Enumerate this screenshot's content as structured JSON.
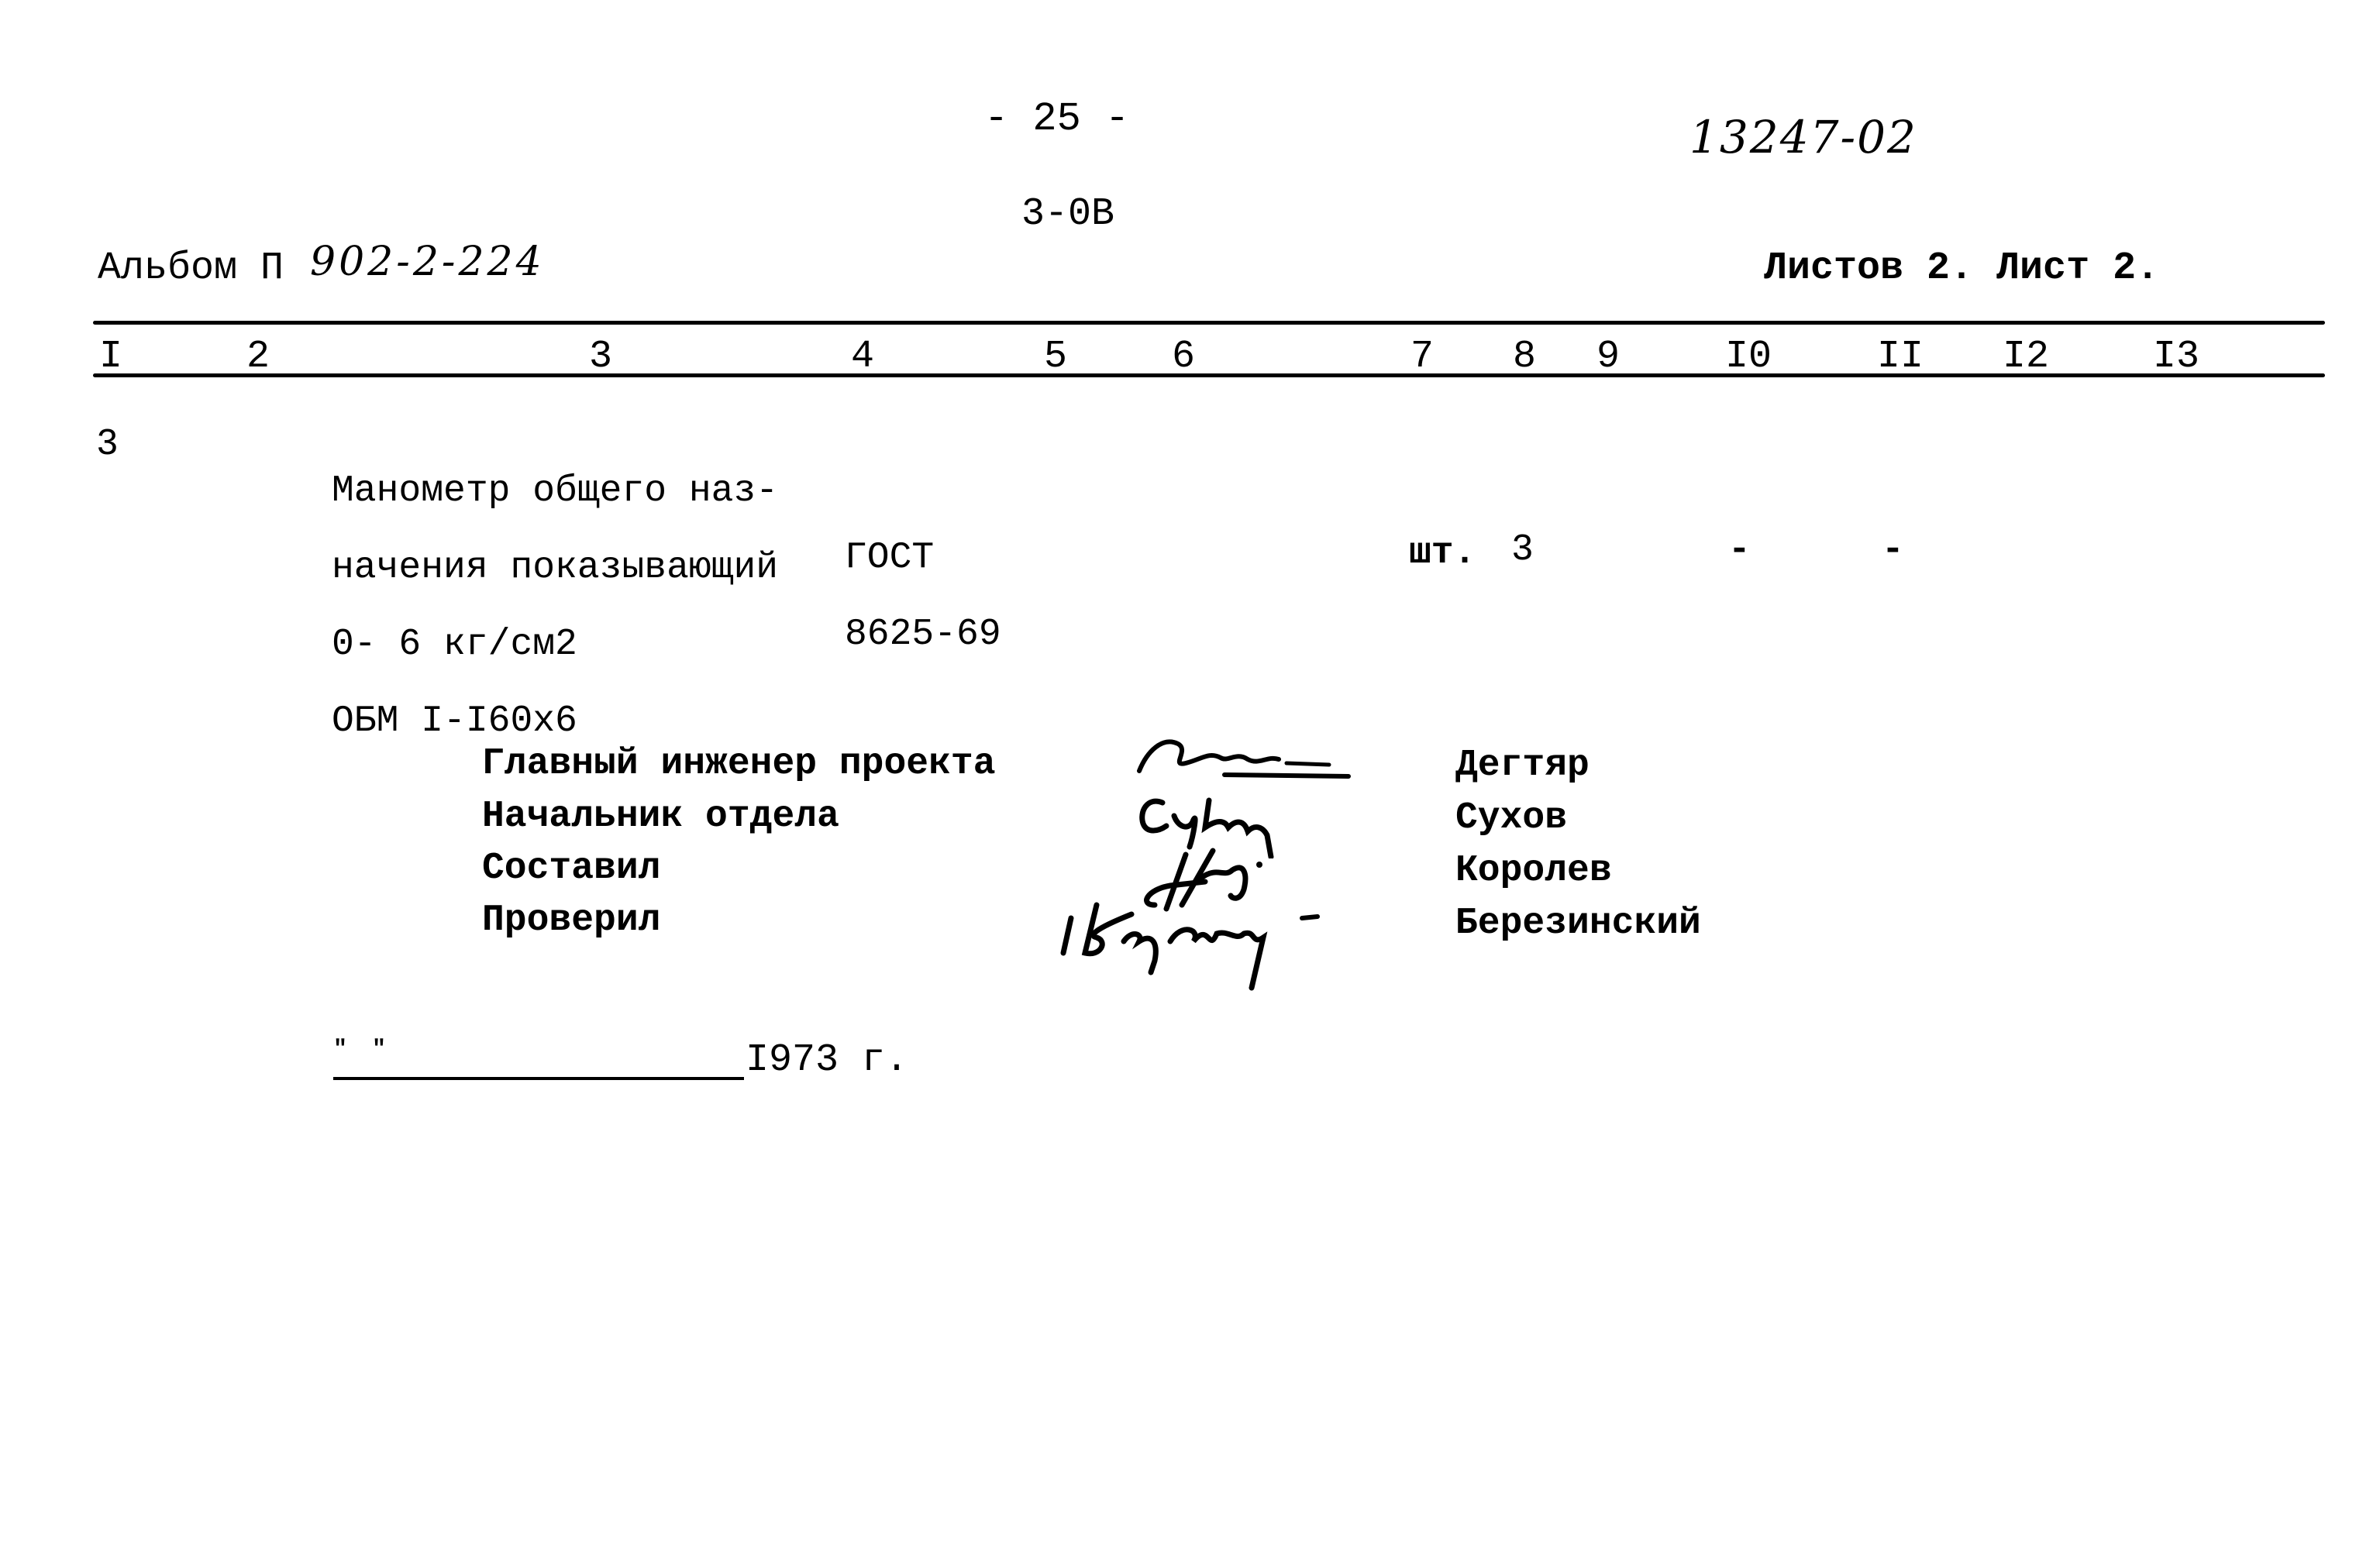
{
  "header": {
    "page_number": "- 25 -",
    "document_number": "13247-02",
    "section_code": "3-0В",
    "album_label": "Альбом П",
    "album_number": "902-2-224",
    "sheets_info": "Листов 2. Лист 2."
  },
  "table": {
    "column_numbers": [
      "I",
      "2",
      "3",
      "4",
      "5",
      "6",
      "7",
      "8",
      "9",
      "I0",
      "II",
      "I2",
      "I3"
    ],
    "rows": [
      {
        "position": "3",
        "description": [
          "Манометр общего наз-",
          "начения показывающий",
          "0- 6 кг/см2",
          "ОБМ I-I60х6"
        ],
        "standard": [
          "ГОСТ",
          "8625-69"
        ],
        "unit": "шт.",
        "quantity": "3",
        "col10": "-",
        "col11": "-"
      }
    ]
  },
  "signatures": [
    {
      "role": "Главный инженер проекта",
      "name": "Дегтяр",
      "signature_icon": "handwritten-signature"
    },
    {
      "role": "Начальник отдела",
      "name": "Сухов",
      "signature_icon": "handwritten-signature"
    },
    {
      "role": "Составил",
      "name": "Королев",
      "signature_icon": "handwritten-signature"
    },
    {
      "role": "Проверил",
      "name": "Березинский",
      "signature_icon": "handwritten-signature"
    }
  ],
  "date_line": {
    "open_quote": "\"",
    "close_quote": "\"",
    "year": "I973 г."
  }
}
